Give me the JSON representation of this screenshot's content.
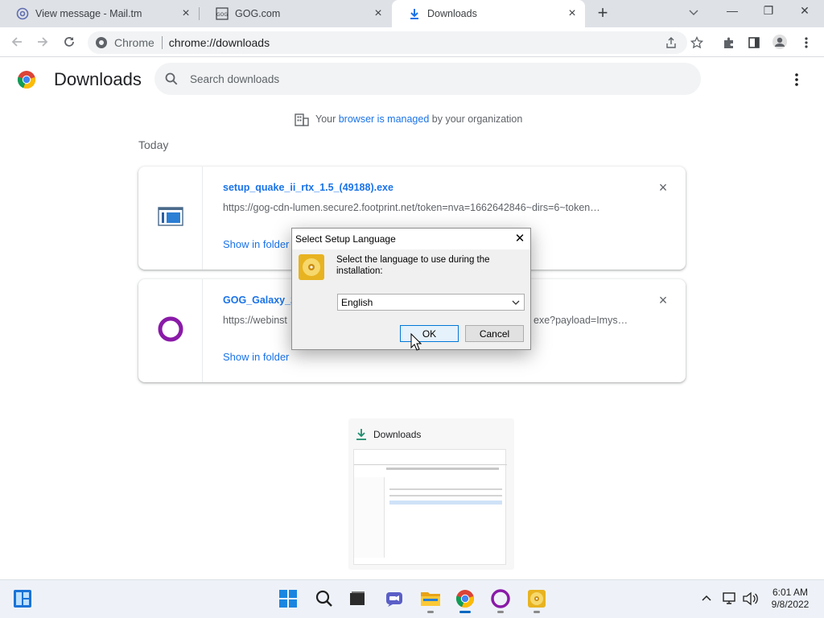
{
  "tabs": [
    {
      "title": "View message - Mail.tm",
      "icon": "at-sign-icon"
    },
    {
      "title": "GOG.com",
      "icon": "gog-icon"
    },
    {
      "title": "Downloads",
      "icon": "download-icon",
      "active": true
    }
  ],
  "window": {
    "minimize": "—",
    "restore": "❐",
    "close": "✕"
  },
  "toolbar": {
    "site_label": "Chrome",
    "url": "chrome://downloads"
  },
  "page": {
    "title": "Downloads",
    "search_placeholder": "Search downloads",
    "managed_prefix": "Your ",
    "managed_link": "browser is managed",
    "managed_suffix": " by your organization",
    "section_label": "Today"
  },
  "downloads": [
    {
      "file": "setup_quake_ii_rtx_1.5_(49188).exe",
      "url": "https://gog-cdn-lumen.secure2.footprint.net/token=nva=1662642846~dirs=6~token…",
      "action": "Show in folder",
      "icon": "installer-icon"
    },
    {
      "file": "GOG_Galaxy_2",
      "url": "https://webinst",
      "url_tail": "exe?payload=Imys…",
      "action": "Show in folder",
      "icon": "gog-galaxy-icon"
    }
  ],
  "dialog": {
    "title": "Select Setup Language",
    "prompt": "Select the language to use during the installation:",
    "selected_language": "English",
    "ok_label": "OK",
    "cancel_label": "Cancel"
  },
  "thumbnail": {
    "label": "Downloads"
  },
  "taskbar": {
    "time": "6:01 AM",
    "date": "9/8/2022"
  },
  "colors": {
    "accent": "#1a73e8",
    "tabstrip": "#dee1e6",
    "taskbar": "#eef2f8",
    "dialog_bg": "#f0f0f0",
    "galaxy": "#8a1aa8"
  }
}
